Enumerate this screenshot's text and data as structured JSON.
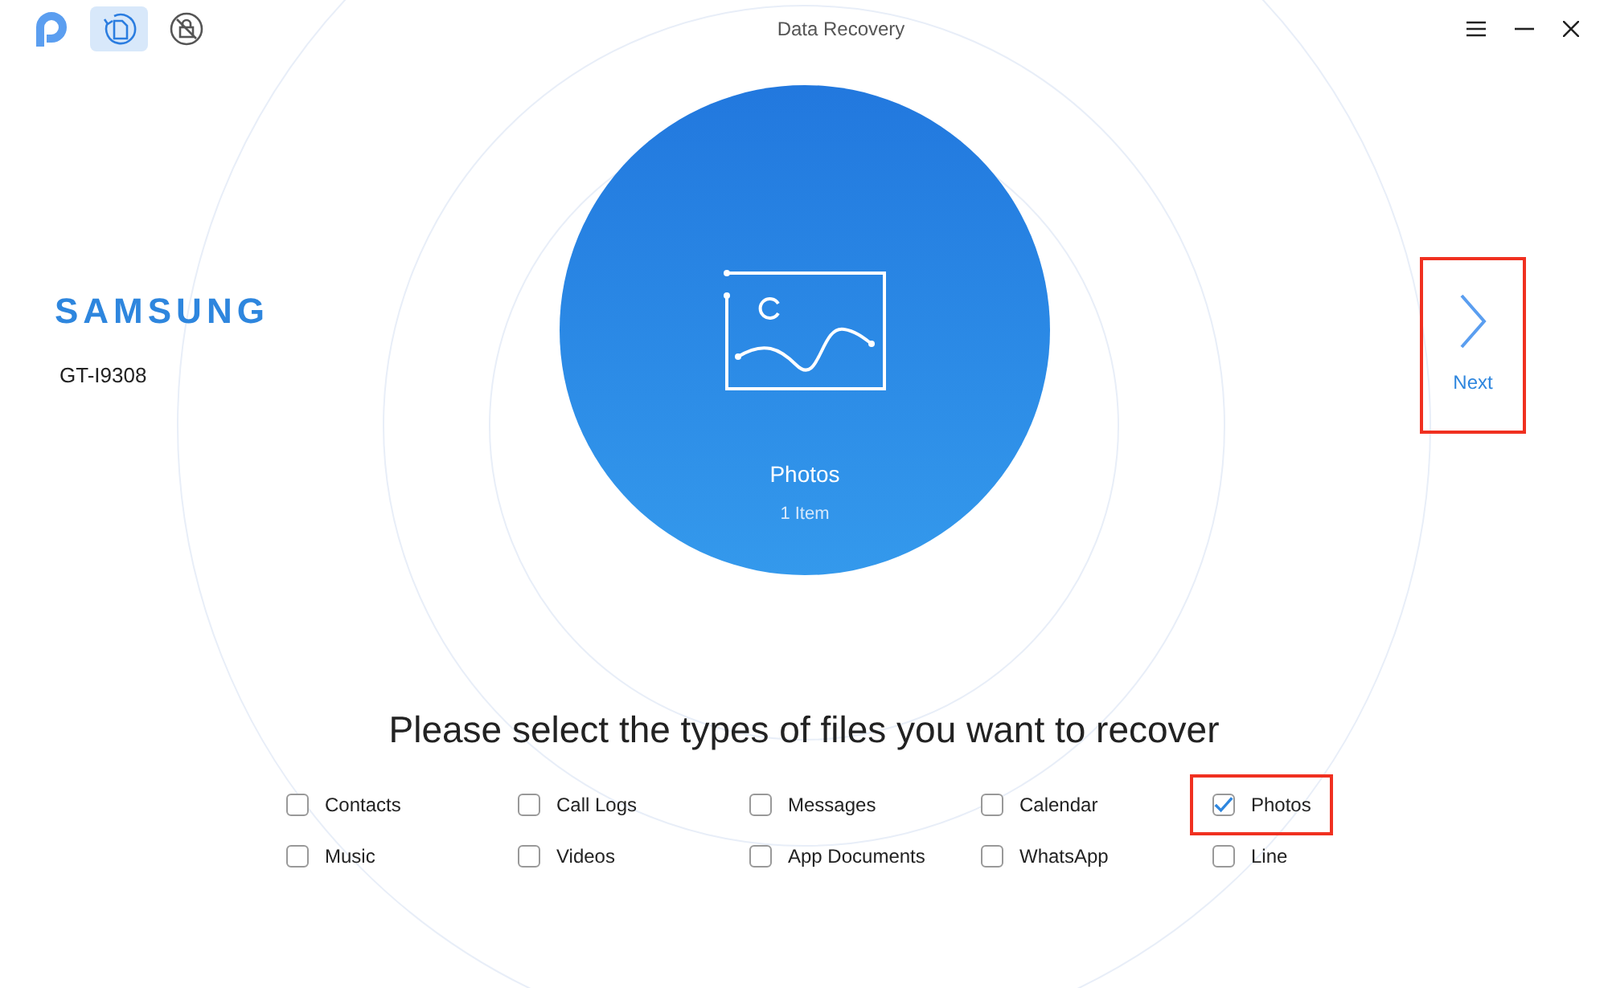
{
  "window": {
    "title": "Data Recovery"
  },
  "toolbar": [
    {
      "kind": "logo",
      "selected": false
    },
    {
      "kind": "recover",
      "selected": true
    },
    {
      "kind": "unlock",
      "selected": false
    }
  ],
  "device": {
    "brand": "SAMSUNG",
    "model": "GT-I9308"
  },
  "preview": {
    "title": "Photos",
    "count": "1 Item"
  },
  "next_button": {
    "label": "Next",
    "highlighted": true
  },
  "prompt": "Please select the types of files you want to recover",
  "file_types": [
    {
      "label": "Contacts",
      "checked": false,
      "highlighted": false
    },
    {
      "label": "Call Logs",
      "checked": false,
      "highlighted": false
    },
    {
      "label": "Messages",
      "checked": false,
      "highlighted": false
    },
    {
      "label": "Calendar",
      "checked": false,
      "highlighted": false
    },
    {
      "label": "Photos",
      "checked": true,
      "highlighted": true
    },
    {
      "label": "Music",
      "checked": false,
      "highlighted": false
    },
    {
      "label": "Videos",
      "checked": false,
      "highlighted": false
    },
    {
      "label": "App Documents",
      "checked": false,
      "highlighted": false
    },
    {
      "label": "WhatsApp",
      "checked": false,
      "highlighted": false
    },
    {
      "label": "Line",
      "checked": false,
      "highlighted": false
    }
  ]
}
